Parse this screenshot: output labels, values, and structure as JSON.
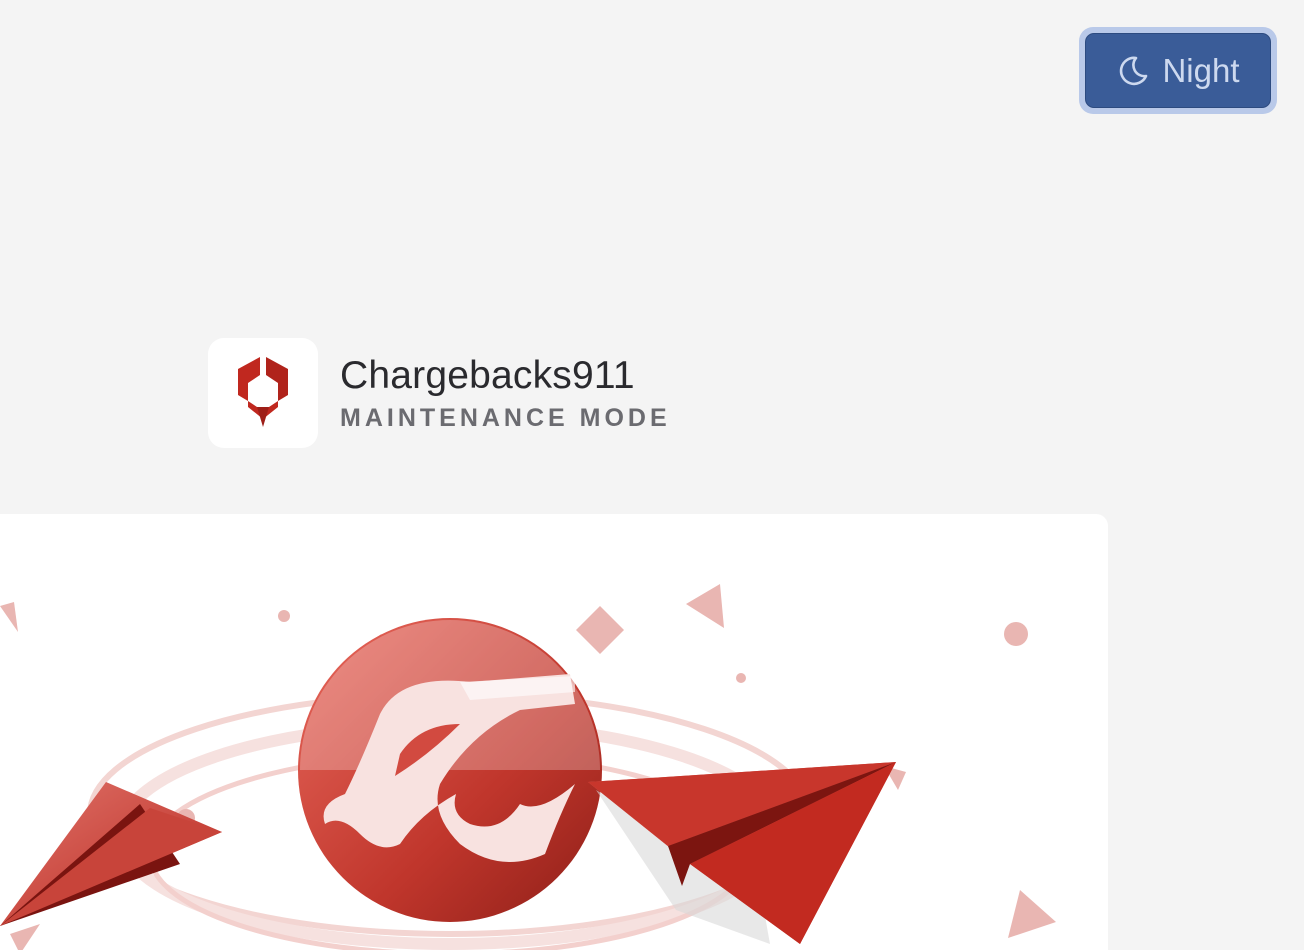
{
  "theme_toggle": {
    "label": "Night",
    "icon": "moon-icon",
    "button_color": "#3a5c98",
    "ring_color": "#b9c9e9"
  },
  "brand": {
    "name": "Chargebacks911",
    "subtitle": "MAINTENANCE MODE",
    "logo_icon": "chargebacks911-logo-icon",
    "accent_color": "#c0281f"
  },
  "illustration": {
    "name": "maintenance-illustration",
    "accent_color": "#c0281f"
  }
}
